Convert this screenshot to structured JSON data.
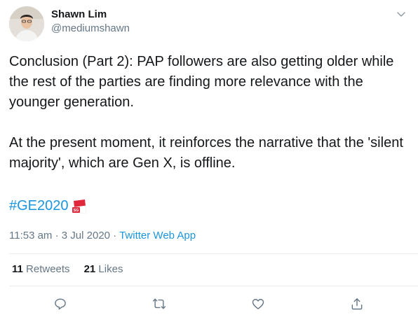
{
  "author": {
    "name": "Shawn Lim",
    "handle": "@mediumshawn"
  },
  "tweet": {
    "paragraphs": [
      "Conclusion (Part 2): PAP followers are also getting older while the rest of the parties are finding more relevance with the younger generation.",
      "At the present moment, it reinforces the narrative that the 'silent majority', which are Gen X, is offline."
    ],
    "hashtag": "#GE2020",
    "hashtag_emoji_label": "SG"
  },
  "meta": {
    "time": "11:53 am",
    "separator": "·",
    "date": "3 Jul 2020",
    "separator2": "·",
    "source": "Twitter Web App"
  },
  "stats": {
    "retweets_count": "11",
    "retweets_label": "Retweets",
    "likes_count": "21",
    "likes_label": "Likes"
  },
  "icons": {
    "more": "chevron-down-icon",
    "reply": "reply-icon",
    "retweet": "retweet-icon",
    "like": "heart-icon",
    "share": "share-icon"
  },
  "colors": {
    "link": "#1b95e0",
    "secondary_text": "#657786",
    "flag_red": "#e0263a"
  }
}
